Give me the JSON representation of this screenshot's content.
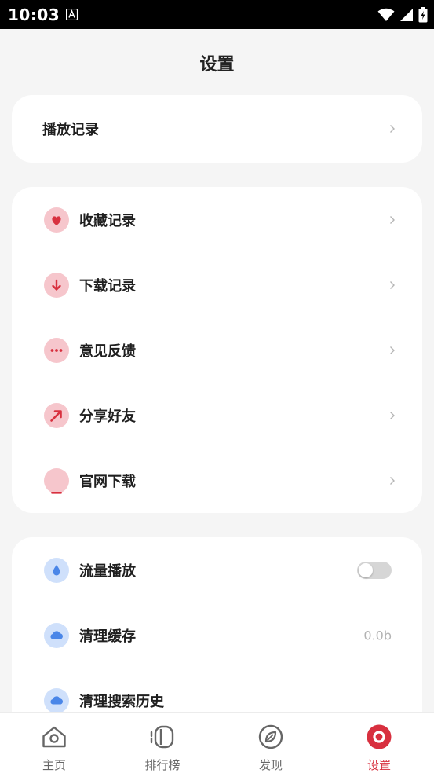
{
  "status_bar": {
    "time": "10:03"
  },
  "page": {
    "title": "设置"
  },
  "history_card": {
    "label": "播放记录"
  },
  "main_menu": {
    "items": [
      {
        "label": "收藏记录",
        "icon": "heart-icon"
      },
      {
        "label": "下载记录",
        "icon": "download-arrow-icon"
      },
      {
        "label": "意见反馈",
        "icon": "feedback-chat-icon"
      },
      {
        "label": "分享好友",
        "icon": "share-arrow-icon"
      },
      {
        "label": "官网下载",
        "icon": "website-icon"
      }
    ]
  },
  "settings_menu": {
    "items": [
      {
        "label": "流量播放",
        "icon": "water-drop-icon",
        "toggle_on": false
      },
      {
        "label": "清理缓存",
        "icon": "cloud-icon",
        "value": "0.0b"
      },
      {
        "label": "清理搜索历史",
        "icon": "cloud-icon"
      }
    ]
  },
  "tabbar": {
    "tabs": [
      {
        "label": "主页",
        "icon": "home-icon",
        "active": false
      },
      {
        "label": "排行榜",
        "icon": "ranking-icon",
        "active": false
      },
      {
        "label": "发现",
        "icon": "discover-compass-icon",
        "active": false
      },
      {
        "label": "设置",
        "icon": "settings-icon",
        "active": true
      }
    ]
  },
  "colors": {
    "accent": "#d8303f",
    "pink_bg": "#f6c6cc",
    "blue_bg": "#cfe0fb",
    "blue_icon": "#4a86e8",
    "page_bg": "#f5f5f5"
  }
}
